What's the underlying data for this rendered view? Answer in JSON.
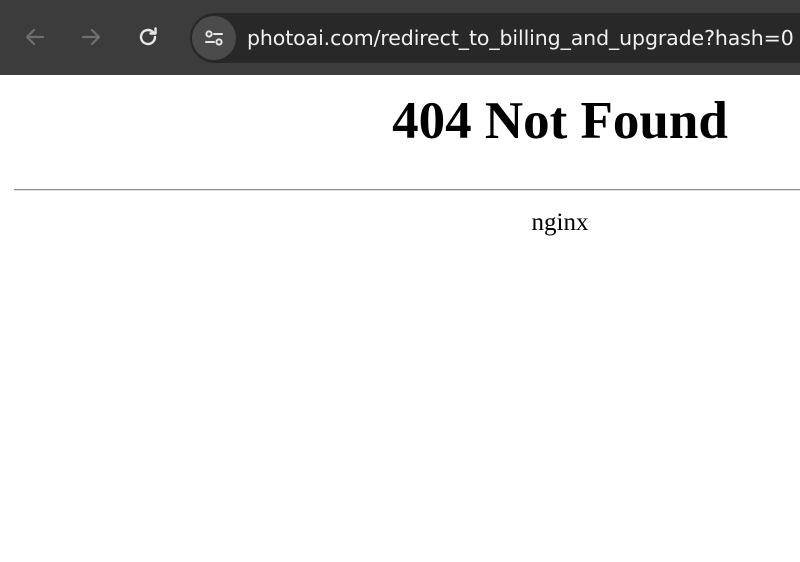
{
  "browser": {
    "url": "photoai.com/redirect_to_billing_and_upgrade?hash=0",
    "icons": {
      "back": "arrow-left-icon",
      "forward": "arrow-right-icon",
      "reload": "reload-icon",
      "site_info": "tune-icon"
    },
    "colors": {
      "toolbar": "#3c3c3c",
      "address_bar": "#282828",
      "url_text": "#f1f1f1"
    }
  },
  "page": {
    "title": "404 Not Found",
    "server": "nginx"
  }
}
